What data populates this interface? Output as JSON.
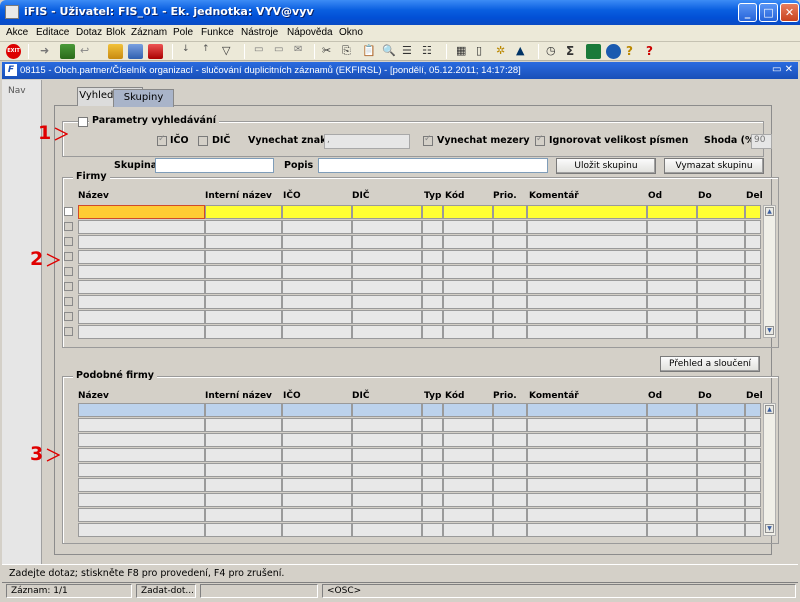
{
  "window": {
    "title": "iFIS - Uživatel: FIS_01 - Ek. jednotka: VYV@vyv",
    "min": "_",
    "max": "□",
    "close": "✕"
  },
  "menu": [
    "Akce",
    "Editace",
    "Dotaz",
    "Blok",
    "Záznam",
    "Pole",
    "Funkce",
    "Nástroje",
    "Nápověda",
    "Okno"
  ],
  "toolbar": {
    "exit_label": "EXIT"
  },
  "form": {
    "icon_letter": "F",
    "title": "08115 - Obch.partner/Číselník organizací - slučování duplicitních záznamů (EKFIRSL) - [pondělí, 05.12.2011; 14:17:28]",
    "ctl": "▭ ✕"
  },
  "nav": {
    "label": "Nav"
  },
  "tabs": {
    "search": "Vyhledávání",
    "groups": "Skupiny"
  },
  "search_params": {
    "title": "Parametry vyhledávání",
    "ico": "IČO",
    "dic": "DIČ",
    "skip_chars": "Vynechat znaky",
    "skip_chars_value": ",",
    "skip_spaces": "Vynechat mezery",
    "ignore_case": "Ignorovat velikost písmen",
    "match": "Shoda (%)",
    "match_value": "90"
  },
  "group_row": {
    "group_label": "Skupina",
    "desc_label": "Popis",
    "save_btn": "Uložit skupinu",
    "delete_btn": "Vymazat skupinu"
  },
  "firms": {
    "title": "Firmy",
    "columns": [
      "Název",
      "Interní název",
      "IČO",
      "DIČ",
      "Typ",
      "Kód",
      "Prio.",
      "Komentář",
      "Od",
      "Do",
      "Del"
    ]
  },
  "overview_btn": "Přehled a sloučení",
  "similar": {
    "title": "Podobné firmy",
    "columns": [
      "Název",
      "Interní název",
      "IČO",
      "DIČ",
      "Typ",
      "Kód",
      "Prio.",
      "Komentář",
      "Od",
      "Do",
      "Del"
    ]
  },
  "markers": [
    "1",
    "2",
    "3"
  ],
  "status": {
    "message": "Zadejte dotaz; stiskněte F8 pro provedení, F4 pro zrušení.",
    "record": "Záznam: 1/1",
    "mode": "Zadat-dot...",
    "osc": "<OSC>"
  },
  "colors": {
    "accent": "#0a5fe0",
    "current_row": "#ffff33",
    "current_cell": "#ffcc33",
    "similar_first": "#bcd2ec",
    "marker": "#e00000"
  }
}
